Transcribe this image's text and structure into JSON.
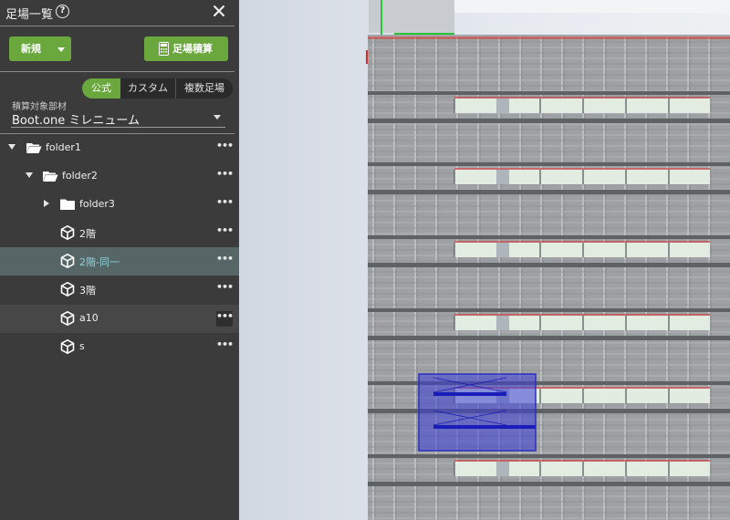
{
  "panel": {
    "title": "足場一覧",
    "help_glyph": "?",
    "new_label": "新規",
    "calc_label": "足場積算"
  },
  "tabs": [
    "公式",
    "カスタム",
    "複数足場"
  ],
  "active_tab": "公式",
  "member_select": {
    "label": "積算対象部材",
    "value": "Boot.one ミレニューム"
  },
  "tree": [
    {
      "label": "folder1",
      "type": "folder",
      "expanded": true
    },
    {
      "label": "folder2",
      "type": "folder",
      "expanded": true
    },
    {
      "label": "folder3",
      "type": "folder",
      "expanded": false
    },
    {
      "label": "2階",
      "type": "scaffold"
    },
    {
      "label": "2階-同一",
      "type": "scaffold",
      "selected": true
    },
    {
      "label": "3階",
      "type": "scaffold"
    },
    {
      "label": "a10",
      "type": "scaffold",
      "hovered": true
    },
    {
      "label": "s",
      "type": "scaffold"
    }
  ],
  "more_glyph": "•••",
  "colors": {
    "accent_green": "#6aa83e",
    "sidebar_bg": "#3b3b3b",
    "selected_row": "#566565",
    "selection_box": "#3b3fd0"
  },
  "icons": {
    "close": "close-icon",
    "help": "help-icon",
    "calculator": "calculator-icon",
    "folder": "folder-icon",
    "scaffold": "cube-icon",
    "more": "more-icon"
  }
}
